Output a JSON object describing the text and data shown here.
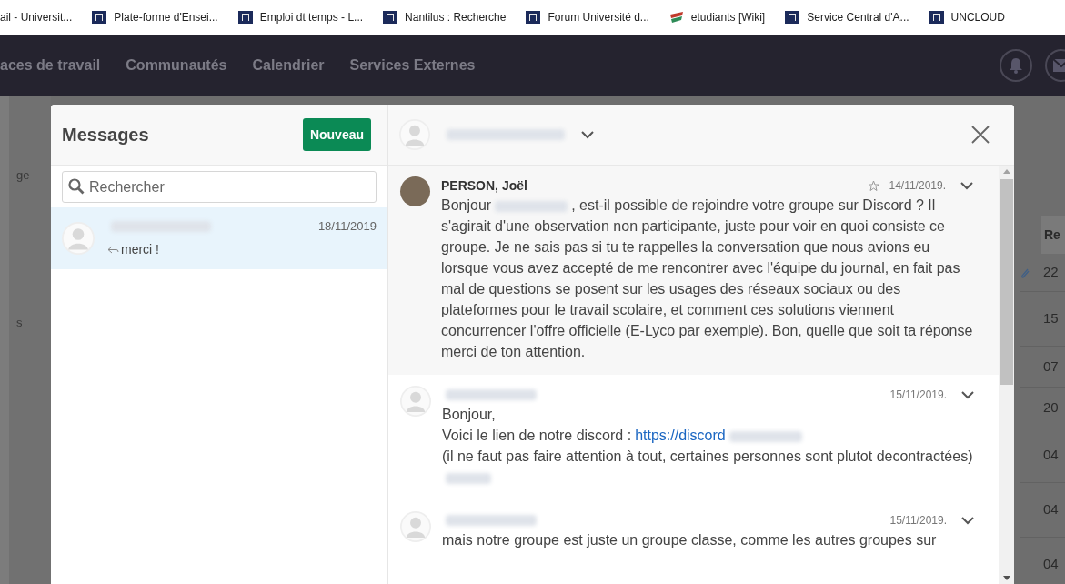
{
  "bookmarks": [
    {
      "label": "ail - Universit...",
      "kind": "plain"
    },
    {
      "label": "Plate-forme d'Ensei...",
      "kind": "site"
    },
    {
      "label": "Emploi dt temps - L...",
      "kind": "site"
    },
    {
      "label": "Nantilus : Recherche",
      "kind": "site"
    },
    {
      "label": "Forum Université d...",
      "kind": "site"
    },
    {
      "label": "etudiants [Wiki]",
      "kind": "wiki"
    },
    {
      "label": "Service Central d'A...",
      "kind": "site"
    },
    {
      "label": "UNCLOUD",
      "kind": "site"
    }
  ],
  "nav": {
    "items": [
      "aces de travail",
      "Communautés",
      "Calendrier",
      "Services Externes"
    ]
  },
  "background_page": {
    "side_texts": [
      "ge",
      "s"
    ],
    "column_header": "Re",
    "cells": [
      "22",
      "15",
      "07",
      "20",
      "04",
      "04",
      "04"
    ]
  },
  "messages_panel": {
    "title": "Messages",
    "new_button": "Nouveau",
    "search": {
      "placeholder": "Rechercher"
    },
    "conversations": [
      {
        "date": "18/11/2019",
        "preview": "merci !",
        "selected": true
      }
    ]
  },
  "thread": {
    "messages": [
      {
        "kind": "photo",
        "author": "PERSON, Joël",
        "date": "14/11/2019.",
        "highlighted": true,
        "lines": [
          {
            "parts": [
              {
                "kind": "text",
                "text": "Bonjour"
              },
              {
                "kind": "blur"
              },
              {
                "kind": "text",
                "text": ", est-il possible de rejoindre votre groupe sur Discord ? Il"
              }
            ]
          },
          {
            "parts": [
              {
                "kind": "text",
                "text": "s'agirait d'une observation non participante, juste pour voir en quoi consiste ce groupe. Je ne sais pas si tu te rappelles la conversation que nous avions eu lorsque vous avez accepté de me rencontrer avec l'équipe du journal, en fait pas mal de questions se posent sur les usages des réseaux sociaux ou des plateformes pour le travail scolaire, et comment ces solutions viennent concurrencer l'offre officielle (E-Lyco par exemple). Bon, quelle que soit ta réponse merci de ton attention."
              }
            ]
          }
        ]
      },
      {
        "kind": "generic",
        "date": "15/11/2019.",
        "highlighted": false,
        "lines": [
          {
            "parts": [
              {
                "kind": "text",
                "text": "Bonjour,"
              }
            ]
          },
          {
            "parts": [
              {
                "kind": "text",
                "text": "Voici le lien de notre discord :"
              },
              {
                "kind": "link",
                "text": "https://discord"
              },
              {
                "kind": "blur"
              }
            ]
          },
          {
            "parts": [
              {
                "kind": "text",
                "text": "(il ne faut pas faire attention à tout, certaines personnes sont plutot decontractées)"
              }
            ]
          },
          {
            "parts": [
              {
                "kind": "blur"
              }
            ]
          }
        ]
      },
      {
        "kind": "generic",
        "date": "15/11/2019.",
        "highlighted": false,
        "lines": [
          {
            "parts": [
              {
                "kind": "text",
                "text": "mais notre groupe est juste un groupe classe, comme les autres groupes sur"
              }
            ]
          }
        ]
      }
    ]
  }
}
